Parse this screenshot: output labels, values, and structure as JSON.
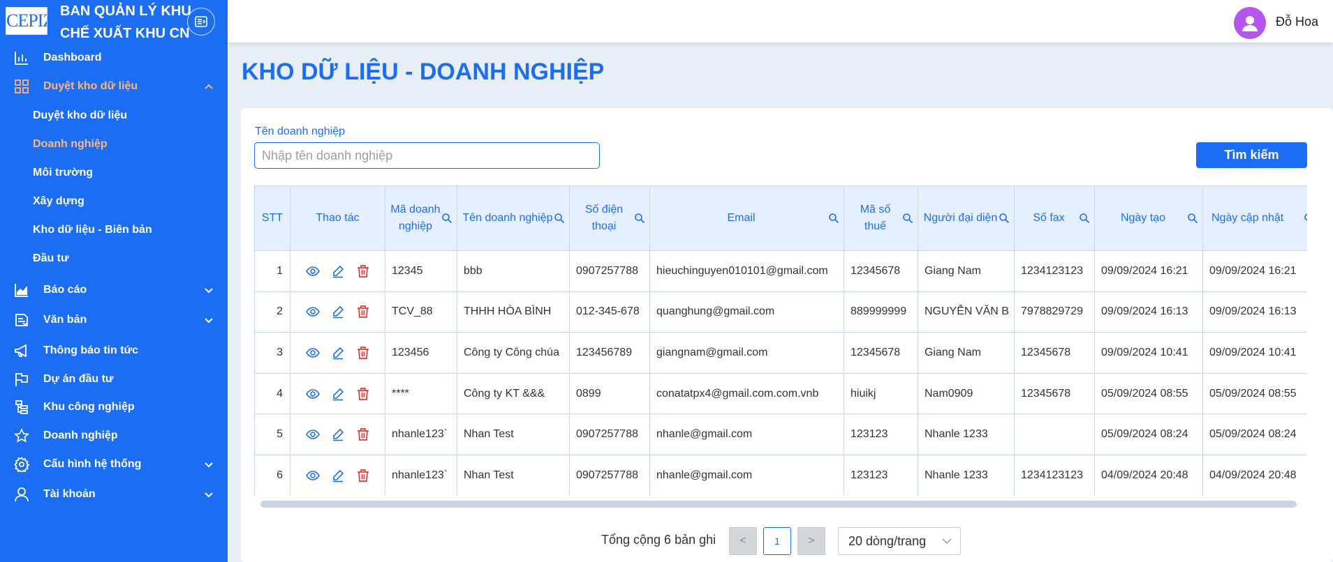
{
  "brand": {
    "logo_text": "CEPIZA",
    "title_line1": "BAN QUẢN LÝ KHU",
    "title_line2": "CHẾ XUẤT KHU CN"
  },
  "sidebar": {
    "items": [
      {
        "label": "Dashboard",
        "icon": "bar-chart-icon"
      },
      {
        "label": "Duyệt kho dữ liệu",
        "icon": "grid-icon",
        "expanded": true
      },
      {
        "label": "Báo cáo",
        "icon": "area-chart-icon"
      },
      {
        "label": "Văn bản",
        "icon": "document-icon"
      },
      {
        "label": "Thông báo tin tức",
        "icon": "megaphone-icon"
      },
      {
        "label": "Dự án đầu tư",
        "icon": "flag-icon"
      },
      {
        "label": "Khu công nghiệp",
        "icon": "hierarchy-icon"
      },
      {
        "label": "Doanh nghiệp",
        "icon": "star-icon"
      },
      {
        "label": "Cấu hình hệ thống",
        "icon": "gear-icon"
      },
      {
        "label": "Tài khoản",
        "icon": "user-icon"
      }
    ],
    "submenu": [
      {
        "label": "Duyệt kho dữ liệu"
      },
      {
        "label": "Doanh nghiệp",
        "active": true
      },
      {
        "label": "Môi trường"
      },
      {
        "label": "Xây dựng"
      },
      {
        "label": "Kho dữ liệu - Biên bản"
      },
      {
        "label": "Đầu tư"
      }
    ]
  },
  "user": {
    "name": "Đỗ Hoa"
  },
  "page": {
    "title": "KHO DỮ LIỆU - DOANH NGHIỆP"
  },
  "search": {
    "label": "Tên doanh nghiệp",
    "placeholder": "Nhập tên doanh nghiệp",
    "value": "",
    "button": "Tìm kiếm"
  },
  "table": {
    "columns": [
      "STT",
      "Thao tác",
      "Mã doanh nghiệp",
      "Tên doanh nghiệp",
      "Số điện thoại",
      "Email",
      "Mã số thuế",
      "Người đại diện",
      "Số fax",
      "Ngày tạo",
      "Ngày cập nhật"
    ],
    "rows": [
      [
        "1",
        "12345",
        "bbb",
        "0907257788",
        "hieuchinguyen010101@gmail.com",
        "12345678",
        "Giang Nam",
        "1234123123",
        "09/09/2024 16:21",
        "09/09/2024 16:21"
      ],
      [
        "2",
        "TCV_88",
        "THHH HÒA BÌNH",
        "012-345-678",
        "quanghung@gmail.com",
        "889999999",
        "NGUYỄN VĂN B",
        "7978829729",
        "09/09/2024 16:13",
        "09/09/2024 16:13"
      ],
      [
        "3",
        "123456",
        "Công ty Công chúa",
        "123456789",
        "giangnam@gmail.com",
        "12345678",
        "Giang Nam",
        "12345678",
        "09/09/2024 10:41",
        "09/09/2024 10:41"
      ],
      [
        "4",
        "****",
        "Công ty KT &&&",
        "0899",
        "conatatpx4@gmail.com.com.vnb",
        "hiuikj",
        "Nam0909",
        "12345678",
        "05/09/2024 08:55",
        "05/09/2024 08:55"
      ],
      [
        "5",
        "nhanle123`",
        "Nhan Test",
        "0907257788",
        "nhanle@gmail.com",
        "123123",
        "Nhanle 1233",
        "",
        "05/09/2024 08:24",
        "05/09/2024 08:24"
      ],
      [
        "6",
        "nhanle123`",
        "Nhan Test",
        "0907257788",
        "nhanle@gmail.com",
        "123123",
        "Nhanle 1233",
        "1234123123",
        "04/09/2024 20:48",
        "04/09/2024 20:48"
      ]
    ]
  },
  "pagination": {
    "total_text": "Tổng cộng 6 bản ghi",
    "prev": "<",
    "current": "1",
    "next": ">",
    "page_size": "20 dòng/trang"
  },
  "colors": {
    "primary": "#1b6ef3",
    "active_menu": "#ffb57a",
    "delete": "#e53935",
    "avatar": "#b455ee"
  }
}
